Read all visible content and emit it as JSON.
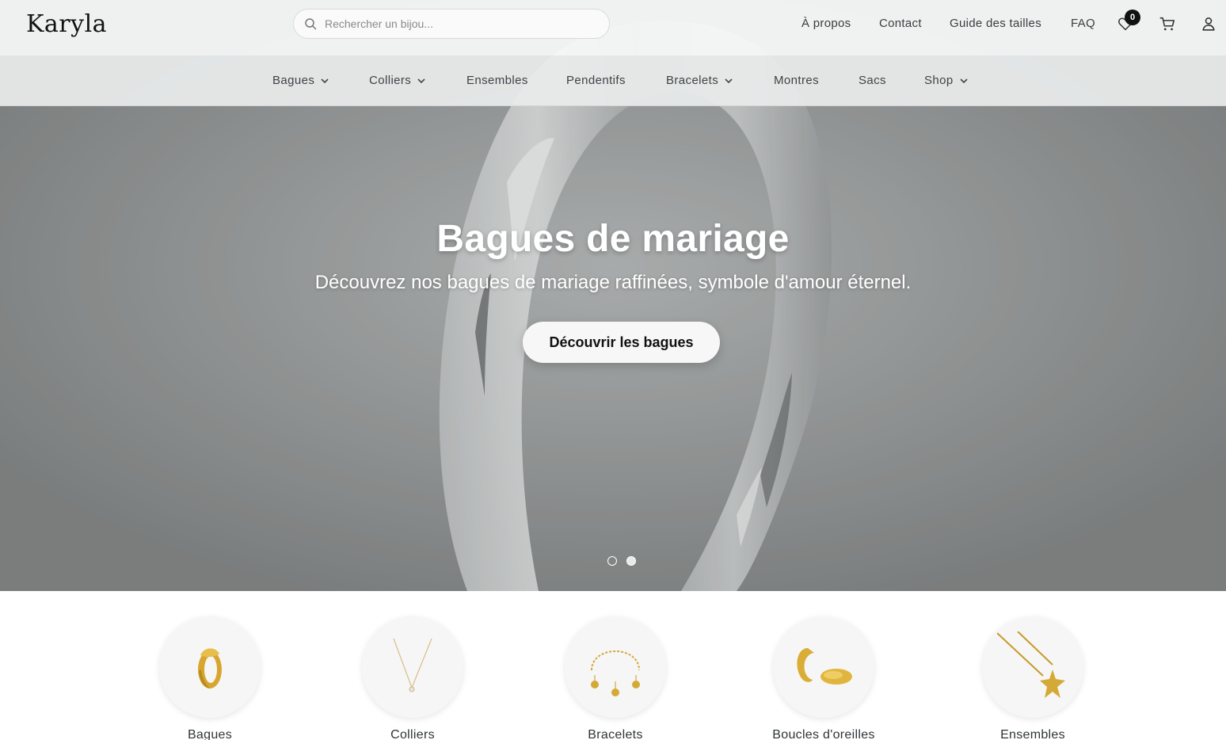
{
  "brand": {
    "logo": "Karyla"
  },
  "search": {
    "placeholder": "Rechercher un bijou..."
  },
  "header_links": [
    "À propos",
    "Contact",
    "Guide des tailles",
    "FAQ"
  ],
  "header_icons": {
    "wishlist": "heart-icon",
    "cart": "cart-icon",
    "account": "user-icon",
    "wishlist_count": "0"
  },
  "nav": {
    "items": [
      {
        "label": "Bagues",
        "has_dropdown": true
      },
      {
        "label": "Colliers",
        "has_dropdown": true
      },
      {
        "label": "Ensembles",
        "has_dropdown": false
      },
      {
        "label": "Pendentifs",
        "has_dropdown": false
      },
      {
        "label": "Bracelets",
        "has_dropdown": true
      },
      {
        "label": "Montres",
        "has_dropdown": false
      },
      {
        "label": "Sacs",
        "has_dropdown": false
      },
      {
        "label": "Shop",
        "has_dropdown": true
      }
    ]
  },
  "hero": {
    "title": "Bagues de mariage",
    "subtitle": "Découvrez nos bagues de mariage raffinées, symbole d'amour éternel.",
    "cta": "Découvrir les bagues",
    "slides_total": 2,
    "active_slide": 2
  },
  "categories": [
    {
      "label": "Bagues",
      "icon": "gold-ring-icon"
    },
    {
      "label": "Colliers",
      "icon": "necklace-icon"
    },
    {
      "label": "Bracelets",
      "icon": "charm-bracelet-icon"
    },
    {
      "label": "Boucles d'oreilles",
      "icon": "hoop-earrings-icon"
    },
    {
      "label": "Ensembles",
      "icon": "starfish-necklace-icon"
    }
  ],
  "colors": {
    "accent": "#111111",
    "gold": "#d4a935",
    "hero_overlay": "#7f8181",
    "cta_bg": "#f7f7f7"
  }
}
